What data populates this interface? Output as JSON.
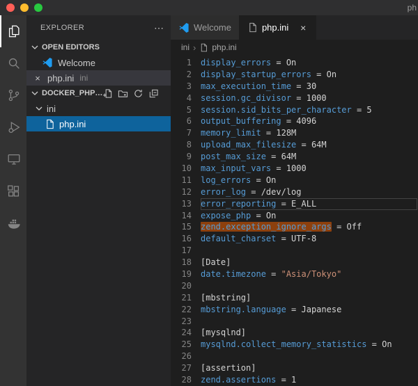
{
  "window": {
    "title": "ph"
  },
  "activity_bar": {
    "items": [
      {
        "name": "explorer",
        "icon": "files-icon",
        "active": true
      },
      {
        "name": "search",
        "icon": "search-icon",
        "active": false
      },
      {
        "name": "source-control",
        "icon": "branch-icon",
        "active": false
      },
      {
        "name": "run-and-debug",
        "icon": "debug-icon",
        "active": false
      },
      {
        "name": "remote-explorer",
        "icon": "monitor-icon",
        "active": false
      },
      {
        "name": "extensions",
        "icon": "extensions-icon",
        "active": false
      },
      {
        "name": "docker",
        "icon": "whale-icon",
        "active": false
      }
    ]
  },
  "sidebar": {
    "title": "EXPLORER",
    "more_label": "⋯",
    "open_editors": {
      "label": "OPEN EDITORS",
      "items": [
        {
          "label": "Welcome",
          "icon": "vscode-logo"
        },
        {
          "label": "php.ini",
          "detail": "ini",
          "close": "×",
          "selected": true
        }
      ]
    },
    "workspace": {
      "label": "DOCKER_PHP…",
      "actions": [
        "new-file",
        "new-folder",
        "refresh",
        "collapse-all"
      ],
      "folder": {
        "label": "ini",
        "expanded": true
      },
      "file": {
        "label": "php.ini",
        "selected": true
      }
    }
  },
  "editor": {
    "tabs": [
      {
        "label": "Welcome",
        "icon": "vscode-logo",
        "active": false
      },
      {
        "label": "php.ini",
        "icon": "file-icon",
        "close": "×",
        "active": true
      }
    ],
    "breadcrumbs": {
      "items": [
        "ini",
        "php.ini"
      ],
      "separator": "›"
    },
    "colors": {
      "key": "#569cd6",
      "text": "#d4d4d4",
      "string": "#ce9178",
      "find_highlight": "#ea5c00",
      "tree_selection": "#0e639c"
    },
    "lines": [
      {
        "num": 1,
        "segs": [
          {
            "c": "key",
            "t": "display_errors"
          },
          {
            "c": "txt",
            "t": " = On"
          }
        ]
      },
      {
        "num": 2,
        "segs": [
          {
            "c": "key",
            "t": "display_startup_errors"
          },
          {
            "c": "txt",
            "t": " = On"
          }
        ]
      },
      {
        "num": 3,
        "segs": [
          {
            "c": "key",
            "t": "max_execution_time"
          },
          {
            "c": "txt",
            "t": " = 30"
          }
        ]
      },
      {
        "num": 4,
        "segs": [
          {
            "c": "key",
            "t": "session.gc_divisor"
          },
          {
            "c": "txt",
            "t": " = 1000"
          }
        ]
      },
      {
        "num": 5,
        "segs": [
          {
            "c": "key",
            "t": "session.sid_bits_per_character"
          },
          {
            "c": "txt",
            "t": " = 5"
          }
        ]
      },
      {
        "num": 6,
        "segs": [
          {
            "c": "key",
            "t": "output_buffering"
          },
          {
            "c": "txt",
            "t": " = 4096"
          }
        ]
      },
      {
        "num": 7,
        "segs": [
          {
            "c": "key",
            "t": "memory_limit"
          },
          {
            "c": "txt",
            "t": " = 128M"
          }
        ]
      },
      {
        "num": 8,
        "segs": [
          {
            "c": "key",
            "t": "upload_max_filesize"
          },
          {
            "c": "txt",
            "t": " = 64M"
          }
        ]
      },
      {
        "num": 9,
        "segs": [
          {
            "c": "key",
            "t": "post_max_size"
          },
          {
            "c": "txt",
            "t": " = 64M"
          }
        ]
      },
      {
        "num": 10,
        "segs": [
          {
            "c": "key",
            "t": "max_input_vars"
          },
          {
            "c": "txt",
            "t": " = 1000"
          }
        ]
      },
      {
        "num": 11,
        "segs": [
          {
            "c": "key",
            "t": "log_errors"
          },
          {
            "c": "txt",
            "t": " = On"
          }
        ]
      },
      {
        "num": 12,
        "segs": [
          {
            "c": "key",
            "t": "error_log"
          },
          {
            "c": "txt",
            "t": " = /dev/log"
          }
        ]
      },
      {
        "num": 13,
        "current": true,
        "segs": [
          {
            "c": "key",
            "t": "error_reporting"
          },
          {
            "c": "txt",
            "t": " = E_ALL"
          }
        ]
      },
      {
        "num": 14,
        "segs": [
          {
            "c": "key",
            "t": "expose_php"
          },
          {
            "c": "txt",
            "t": " = On"
          }
        ]
      },
      {
        "num": 15,
        "segs": [
          {
            "c": "key",
            "t": "zend.exception_ignore_args",
            "hl": true
          },
          {
            "c": "txt",
            "t": " = Off"
          }
        ]
      },
      {
        "num": 16,
        "segs": [
          {
            "c": "key",
            "t": "default_charset"
          },
          {
            "c": "txt",
            "t": " = UTF-8"
          }
        ]
      },
      {
        "num": 17,
        "segs": []
      },
      {
        "num": 18,
        "segs": [
          {
            "c": "sec",
            "t": "[Date]"
          }
        ]
      },
      {
        "num": 19,
        "segs": [
          {
            "c": "key",
            "t": "date.timezone"
          },
          {
            "c": "txt",
            "t": " = "
          },
          {
            "c": "str",
            "t": "\"Asia/Tokyo\""
          }
        ]
      },
      {
        "num": 20,
        "segs": []
      },
      {
        "num": 21,
        "segs": [
          {
            "c": "sec",
            "t": "[mbstring]"
          }
        ]
      },
      {
        "num": 22,
        "segs": [
          {
            "c": "key",
            "t": "mbstring.language"
          },
          {
            "c": "txt",
            "t": " = Japanese"
          }
        ]
      },
      {
        "num": 23,
        "segs": []
      },
      {
        "num": 24,
        "segs": [
          {
            "c": "sec",
            "t": "[mysqlnd]"
          }
        ]
      },
      {
        "num": 25,
        "segs": [
          {
            "c": "key",
            "t": "mysqlnd.collect_memory_statistics"
          },
          {
            "c": "txt",
            "t": " = On"
          }
        ]
      },
      {
        "num": 26,
        "segs": []
      },
      {
        "num": 27,
        "segs": [
          {
            "c": "sec",
            "t": "[assertion]"
          }
        ]
      },
      {
        "num": 28,
        "segs": [
          {
            "c": "key",
            "t": "zend.assertions"
          },
          {
            "c": "txt",
            "t": " = 1"
          }
        ]
      }
    ]
  }
}
